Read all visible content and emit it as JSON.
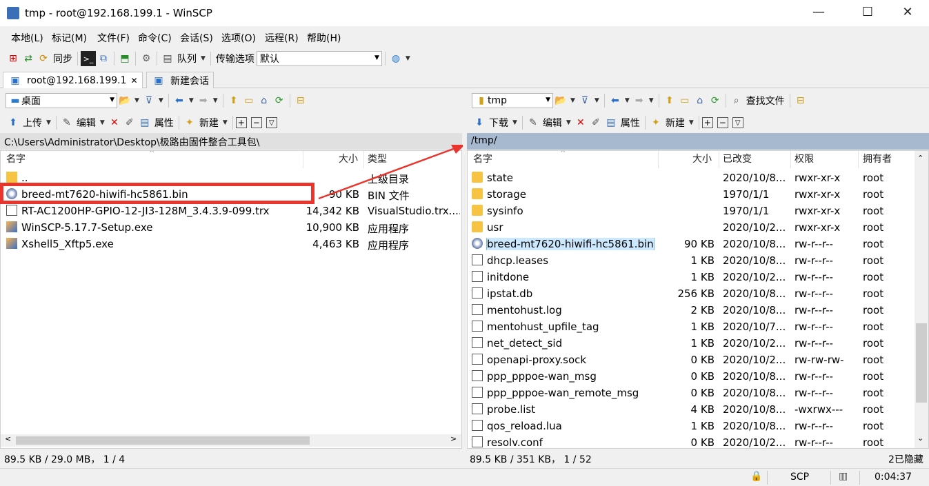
{
  "window": {
    "title": "tmp - root@192.168.199.1 - WinSCP",
    "min": "—",
    "max": "☐",
    "close": "✕"
  },
  "menu": [
    "本地(L)",
    "标记(M)",
    "文件(F)",
    "命令(C)",
    "会话(S)",
    "选项(O)",
    "远程(R)",
    "帮助(H)"
  ],
  "toolbar": {
    "sync": "同步",
    "queue": "队列",
    "transfer_options": "传输选项",
    "transfer_value": "默认"
  },
  "tabs": [
    {
      "label": "root@192.168.199.1",
      "close": "✕"
    },
    {
      "label": "新建会话"
    }
  ],
  "left": {
    "location": "桌面",
    "actions": {
      "upload": "上传",
      "edit": "编辑",
      "props": "属性",
      "new": "新建"
    },
    "path": "C:\\Users\\Administrator\\Desktop\\极路由固件整合工具包\\",
    "columns": [
      "名字",
      "大小",
      "类型"
    ],
    "rows": [
      {
        "icon": "up",
        "name": "..",
        "size": "",
        "type": "上级目录"
      },
      {
        "icon": "bin",
        "name": "breed-mt7620-hiwifi-hc5861.bin",
        "size": "90 KB",
        "type": "BIN 文件"
      },
      {
        "icon": "file",
        "name": "RT-AC1200HP-GPIO-12-JI3-128M_3.4.3.9-099.trx",
        "size": "14,342 KB",
        "type": "VisualStudio.trx...."
      },
      {
        "icon": "exe",
        "name": "WinSCP-5.17.7-Setup.exe",
        "size": "10,900 KB",
        "type": "应用程序"
      },
      {
        "icon": "exe",
        "name": "Xshell5_Xftp5.exe",
        "size": "4,463 KB",
        "type": "应用程序"
      }
    ],
    "status": "89.5 KB / 29.0 MB，  1 / 4"
  },
  "right": {
    "location": "tmp",
    "actions": {
      "download": "下载",
      "edit": "编辑",
      "props": "属性",
      "new": "新建",
      "find": "查找文件"
    },
    "path": "/tmp/",
    "columns": [
      "名字",
      "大小",
      "已改变",
      "权限",
      "拥有者"
    ],
    "rows": [
      {
        "icon": "folder",
        "name": "state",
        "size": "",
        "changed": "2020/10/8...",
        "rights": "rwxr-xr-x",
        "owner": "root"
      },
      {
        "icon": "folder",
        "name": "storage",
        "size": "",
        "changed": "1970/1/1",
        "rights": "rwxr-xr-x",
        "owner": "root"
      },
      {
        "icon": "folder",
        "name": "sysinfo",
        "size": "",
        "changed": "1970/1/1",
        "rights": "rwxr-xr-x",
        "owner": "root"
      },
      {
        "icon": "folder",
        "name": "usr",
        "size": "",
        "changed": "2020/10/2...",
        "rights": "rwxr-xr-x",
        "owner": "root"
      },
      {
        "icon": "bin",
        "name": "breed-mt7620-hiwifi-hc5861.bin",
        "size": "90 KB",
        "changed": "2020/10/8...",
        "rights": "rw-r--r--",
        "owner": "root"
      },
      {
        "icon": "file",
        "name": "dhcp.leases",
        "size": "1 KB",
        "changed": "2020/10/8...",
        "rights": "rw-r--r--",
        "owner": "root"
      },
      {
        "icon": "file",
        "name": "initdone",
        "size": "1 KB",
        "changed": "2020/10/2...",
        "rights": "rw-r--r--",
        "owner": "root"
      },
      {
        "icon": "file",
        "name": "ipstat.db",
        "size": "256 KB",
        "changed": "2020/10/8...",
        "rights": "rw-r--r--",
        "owner": "root"
      },
      {
        "icon": "file",
        "name": "mentohust.log",
        "size": "2 KB",
        "changed": "2020/10/8...",
        "rights": "rw-r--r--",
        "owner": "root"
      },
      {
        "icon": "file",
        "name": "mentohust_upfile_tag",
        "size": "1 KB",
        "changed": "2020/10/7...",
        "rights": "rw-r--r--",
        "owner": "root"
      },
      {
        "icon": "file",
        "name": "net_detect_sid",
        "size": "1 KB",
        "changed": "2020/10/2...",
        "rights": "rw-r--r--",
        "owner": "root"
      },
      {
        "icon": "file",
        "name": "openapi-proxy.sock",
        "size": "0 KB",
        "changed": "2020/10/2...",
        "rights": "rw-rw-rw-",
        "owner": "root"
      },
      {
        "icon": "file",
        "name": "ppp_pppoe-wan_msg",
        "size": "0 KB",
        "changed": "2020/10/8...",
        "rights": "rw-r--r--",
        "owner": "root"
      },
      {
        "icon": "file",
        "name": "ppp_pppoe-wan_remote_msg",
        "size": "0 KB",
        "changed": "2020/10/8...",
        "rights": "rw-r--r--",
        "owner": "root"
      },
      {
        "icon": "file",
        "name": "probe.list",
        "size": "4 KB",
        "changed": "2020/10/8...",
        "rights": "-wxrwx---",
        "owner": "root"
      },
      {
        "icon": "file",
        "name": "qos_reload.lua",
        "size": "1 KB",
        "changed": "2020/10/8...",
        "rights": "rw-r--r--",
        "owner": "root"
      },
      {
        "icon": "file",
        "name": "resolv.conf",
        "size": "0 KB",
        "changed": "2020/10/2...",
        "rights": "rw-r--r--",
        "owner": "root"
      }
    ],
    "status": "89.5 KB / 351 KB，  1 / 52",
    "hidden": "2已隐藏"
  },
  "statusbar": {
    "protocol": "SCP",
    "time": "0:04:37"
  },
  "colors": {
    "path_bg": "#a6b9cf",
    "highlight": "#e8362f",
    "select_bg": "#cce8ff"
  }
}
